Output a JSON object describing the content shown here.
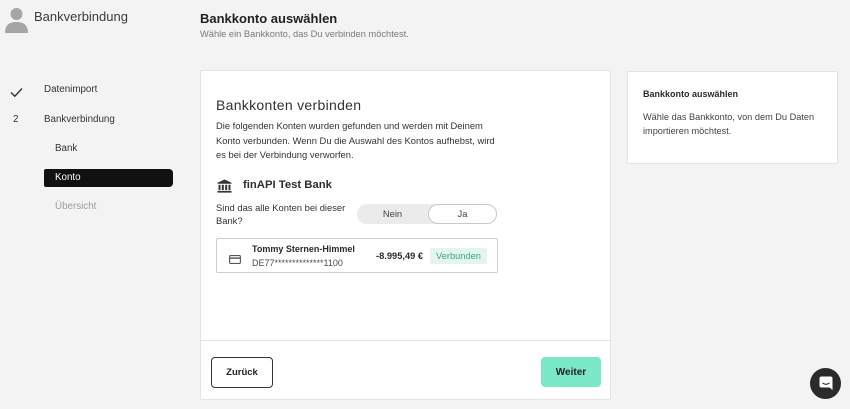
{
  "colors": {
    "page_bg": "#f3f3f3",
    "card_bg": "#ffffff",
    "border": "#e3e3e3",
    "text": "#2e2e2e",
    "muted": "#7a7a7a",
    "accent": "#7be8c8",
    "active_nav": "#111111",
    "badge_bg": "#e3f6ee",
    "badge_text": "#3ba384",
    "chat_bg": "#2b2b2b"
  },
  "sidebar": {
    "avatar_icon": "user-icon",
    "title": "Bankverbindung",
    "steps": [
      {
        "icon": "checkmark-icon",
        "label": "Datenimport",
        "completed": true
      },
      {
        "marker": "2",
        "label": "Bankverbindung",
        "completed": false
      }
    ],
    "substeps": [
      {
        "label": "Bank",
        "active": false,
        "enabled": true
      },
      {
        "label": "Konto",
        "active": true,
        "enabled": true
      },
      {
        "label": "Übersicht",
        "active": false,
        "enabled": false
      }
    ]
  },
  "header": {
    "title": "Bankkonto auswählen",
    "subtitle": "Wähle ein Bankkonto, das Du verbinden möchtest."
  },
  "main": {
    "heading": "Bankkonten verbinden",
    "description": "Die folgenden Konten wurden gefunden und werden mit Deinem Konto verbunden. Wenn Du die Auswahl des Kontos aufhebst, wird es bei der Verbindung verworfen.",
    "bank": {
      "icon": "bank-icon",
      "name": "finAPI Test Bank"
    },
    "question": "Sind das alle Konten bei dieser Bank?",
    "toggle": {
      "options": [
        {
          "label": "Nein",
          "selected": false
        },
        {
          "label": "Ja",
          "selected": true
        }
      ]
    },
    "accounts": [
      {
        "icon": "credit-card-icon",
        "holder": "Tommy Sternen-Himmel",
        "iban": "DE77**************1100",
        "balance": "-8.995,49 €",
        "status": "Verbunden"
      }
    ],
    "back_label": "Zurück",
    "next_label": "Weiter"
  },
  "info": {
    "title": "Bankkonto auswählen",
    "text": "Wähle das Bankkonto, von dem Du Daten importieren möchtest."
  },
  "chat": {
    "icon": "chat-icon"
  }
}
